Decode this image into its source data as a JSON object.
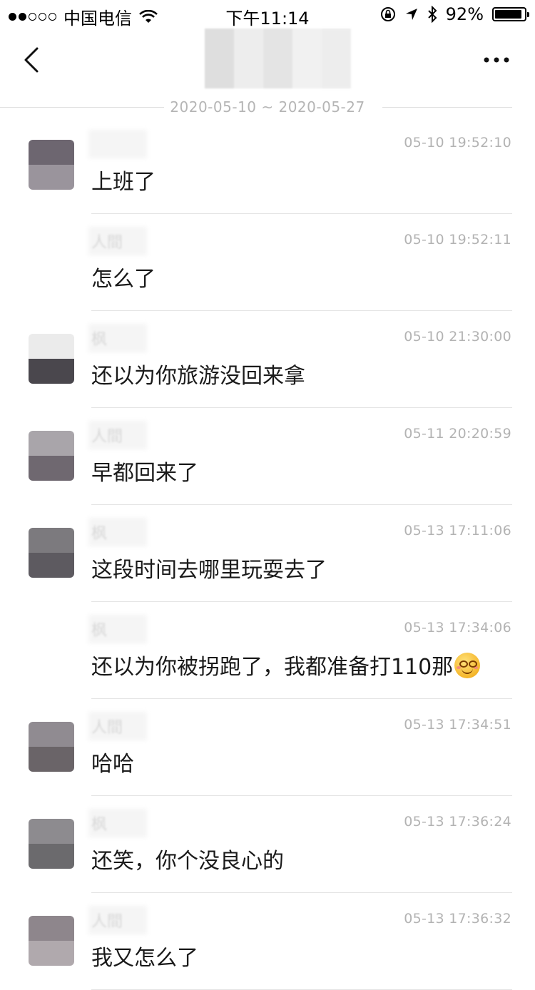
{
  "status_bar": {
    "carrier": "中国电信",
    "time": "下午11:14",
    "battery_percent": "92%",
    "battery_level": 0.92,
    "signal_bars": 2,
    "icons": [
      "wifi-icon",
      "orientation-lock-icon",
      "location-icon",
      "bluetooth-icon",
      "battery-icon"
    ]
  },
  "nav": {
    "back_icon": "chevron-left-icon",
    "more_icon": "more-dots-icon"
  },
  "date_range": "2020-05-10 ~ 2020-05-27",
  "messages": [
    {
      "sender": "",
      "timestamp": "05-10 19:52:10",
      "text": "上班了",
      "avatar": [
        "#6d6670",
        "#9a949c"
      ]
    },
    {
      "sender": "人間",
      "timestamp": "05-10 19:52:11",
      "text": "怎么了",
      "avatar": []
    },
    {
      "sender": "枫",
      "timestamp": "05-10 21:30:00",
      "text": "还以为你旅游没回来拿",
      "avatar": [
        "#ebebeb",
        "#4a474d"
      ]
    },
    {
      "sender": "人間",
      "timestamp": "05-11 20:20:59",
      "text": "早都回来了",
      "avatar": [
        "#a9a5aa",
        "#6f6870"
      ]
    },
    {
      "sender": "枫",
      "timestamp": "05-13 17:11:06",
      "text": "这段时间去哪里玩耍去了",
      "avatar": [
        "#7c7a7e",
        "#5d5a60"
      ]
    },
    {
      "sender": "枫",
      "timestamp": "05-13 17:34:06",
      "text": "还以为你被拐跑了，我都准备打110那",
      "emoji": "flushed-smile-emoji",
      "avatar": []
    },
    {
      "sender": "人間",
      "timestamp": "05-13 17:34:51",
      "text": "哈哈",
      "avatar": [
        "#908b91",
        "#6a6468"
      ]
    },
    {
      "sender": "枫",
      "timestamp": "05-13 17:36:24",
      "text": "还笑，你个没良心的",
      "avatar": [
        "#8d8b8f",
        "#6b6a6d"
      ]
    },
    {
      "sender": "人間",
      "timestamp": "05-13 17:36:32",
      "text": "我又怎么了",
      "avatar": [
        "#8e868c",
        "#b0a9ad"
      ]
    }
  ]
}
